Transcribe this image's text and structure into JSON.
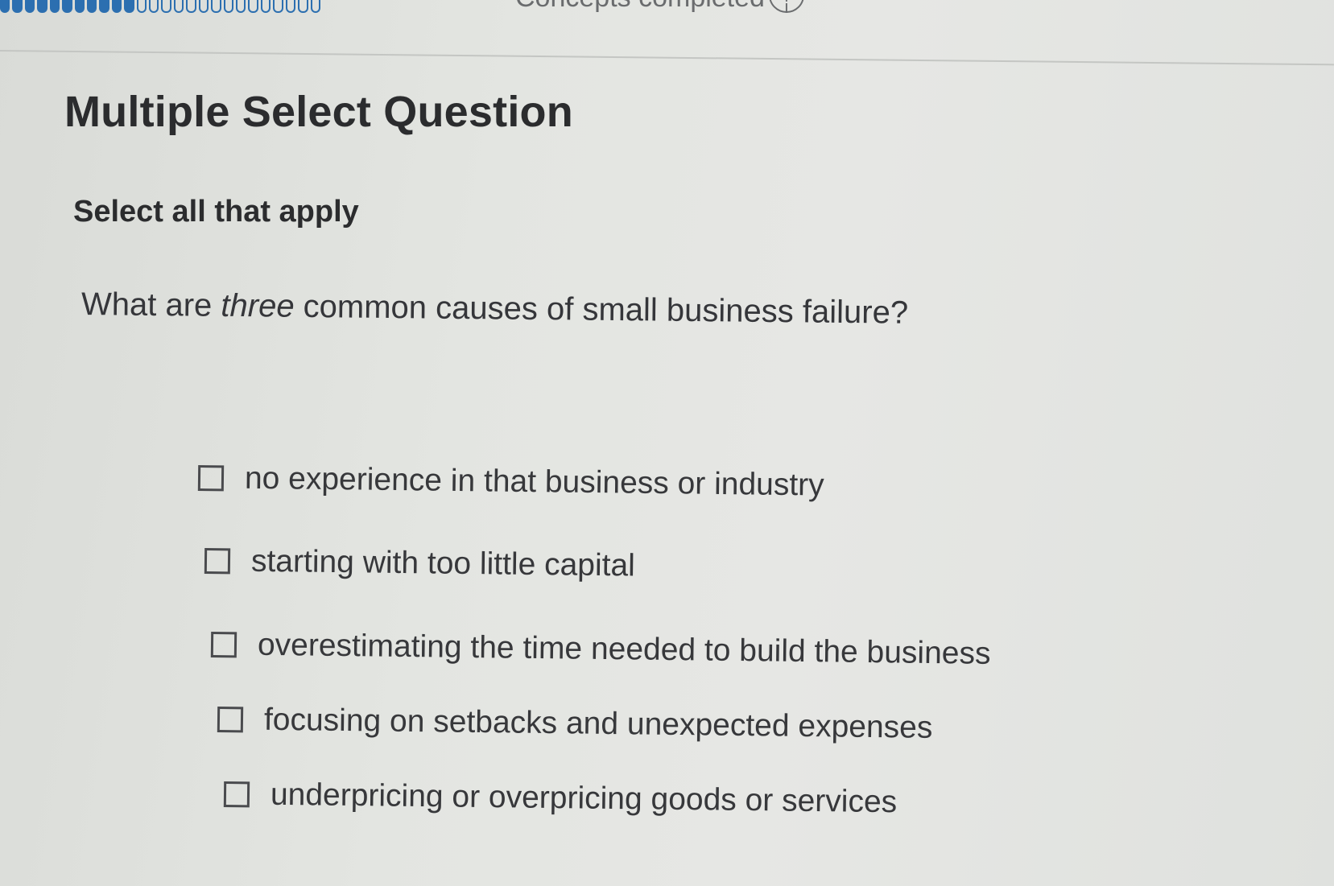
{
  "header": {
    "progress": {
      "completed_segments": 11,
      "total_segments": 26,
      "color": "#2c6fb0"
    },
    "concepts_label": "Concepts completed",
    "info_icon": "info-circle-icon"
  },
  "question": {
    "type_title": "Multiple Select Question",
    "instruction": "Select all that apply",
    "prompt_before": "What are ",
    "prompt_emphasis": "three",
    "prompt_after": " common causes of small business failure?"
  },
  "options": [
    {
      "label": "no experience in that business or industry",
      "checked": false
    },
    {
      "label": "starting with too little capital",
      "checked": false
    },
    {
      "label": "overestimating the time needed to build the business",
      "checked": false
    },
    {
      "label": "focusing on setbacks and unexpected expenses",
      "checked": false
    },
    {
      "label": "underpricing or overpricing goods or services",
      "checked": false
    }
  ]
}
